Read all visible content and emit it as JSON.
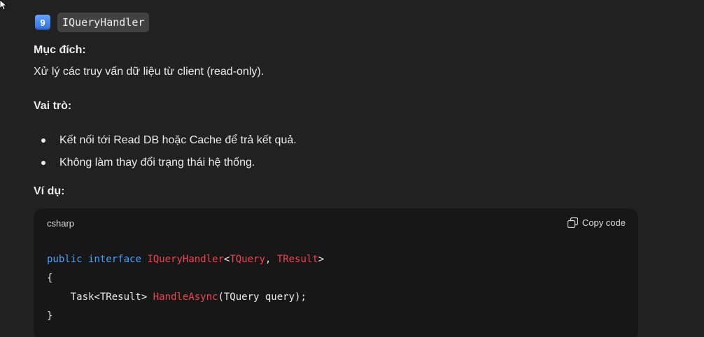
{
  "heading": {
    "badge": "9",
    "code": "IQueryHandler"
  },
  "purpose": {
    "label": "Mục đích:",
    "text": "Xử lý các truy vấn dữ liệu từ client (read-only)."
  },
  "role": {
    "label": "Vai trò:",
    "items": [
      "Kết nối tới Read DB hoặc Cache để trả kết quả.",
      "Không làm thay đổi trạng thái hệ thống."
    ]
  },
  "example": {
    "label": "Ví dụ:"
  },
  "code_block": {
    "language": "csharp",
    "copy_label": "Copy code",
    "tokens": {
      "public": "public",
      "interface": "interface",
      "name": "IQueryHandler",
      "lt": "<",
      "tquery": "TQuery",
      "comma": ", ",
      "tresult": "TResult",
      "gt": ">",
      "open_brace": "{",
      "indent_task": "    Task<TResult> ",
      "method": "HandleAsync",
      "params": "(TQuery query);",
      "close_brace": "}"
    }
  },
  "colors": {
    "background": "#212121",
    "code_background": "#171717",
    "keyword": "#4aa3ff",
    "type_name": "#ef4452",
    "inline_code_bg": "#424242"
  }
}
